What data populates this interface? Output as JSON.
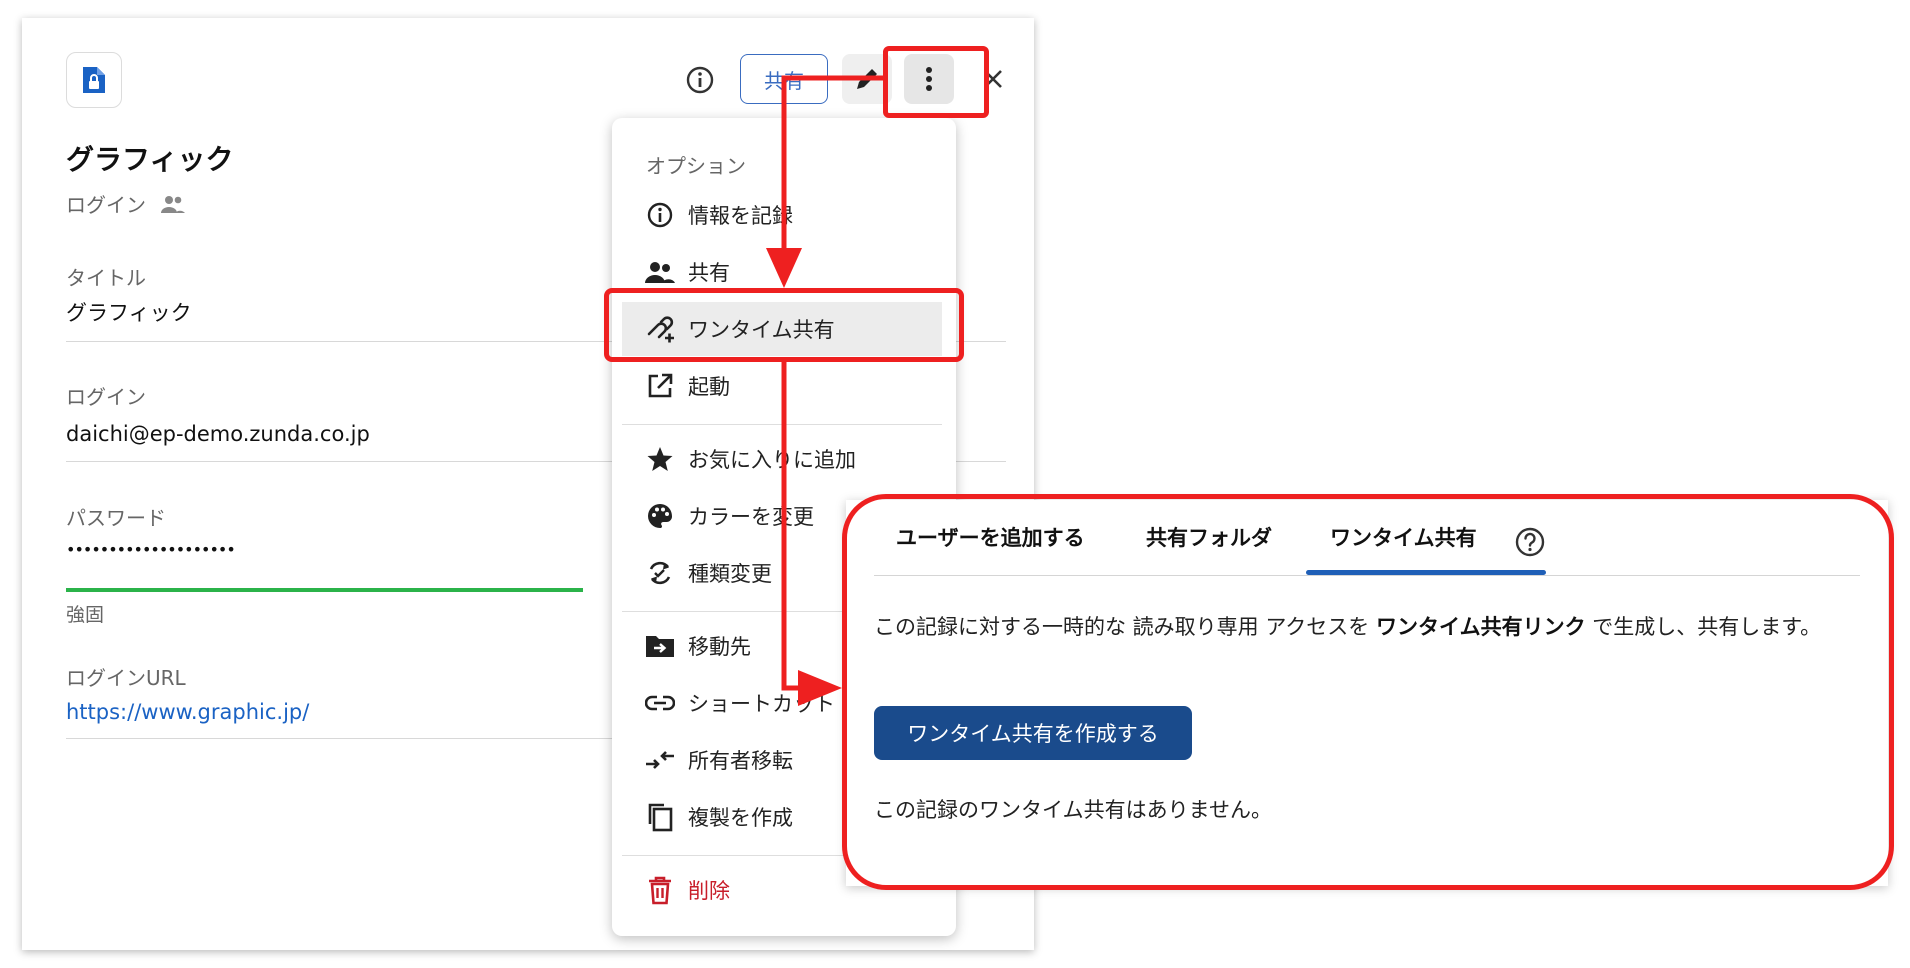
{
  "record": {
    "title": "グラフィック",
    "type_label": "ログイン",
    "fields": [
      {
        "label": "タイトル",
        "value": "グラフィック"
      },
      {
        "label": "ログイン",
        "value": "daichi@ep-demo.zunda.co.jp"
      },
      {
        "label": "パスワード",
        "value": "••••••••••••••••••••"
      },
      {
        "label": "ログインURL",
        "value": "https://www.graphic.jp/"
      }
    ],
    "password_strength": "強固",
    "password_strength_fraction": 0.55,
    "strength_color": "#2bb34a"
  },
  "header": {
    "share_label": "共有",
    "icons": [
      "file-lock-icon",
      "info-icon",
      "edit-icon",
      "more-vert-icon",
      "close-icon"
    ]
  },
  "options_menu": {
    "heading": "オプション",
    "items": [
      {
        "label": "情報を記録",
        "icon": "info-icon"
      },
      {
        "label": "共有",
        "icon": "people-icon"
      },
      {
        "label": "ワンタイム共有",
        "icon": "link-add-icon",
        "highlighted": true
      },
      {
        "label": "起動",
        "icon": "open-external-icon"
      },
      {
        "label": "お気に入りに追加",
        "icon": "star-icon"
      },
      {
        "label": "カラーを変更",
        "icon": "palette-icon"
      },
      {
        "label": "種類変更",
        "icon": "convert-icon"
      },
      {
        "label": "移動先",
        "icon": "move-folder-icon"
      },
      {
        "label": "ショートカット",
        "icon": "link-icon"
      },
      {
        "label": "所有者移転",
        "icon": "transfer-icon"
      },
      {
        "label": "複製を作成",
        "icon": "copy-icon"
      },
      {
        "label": "削除",
        "icon": "trash-icon",
        "danger": true
      }
    ]
  },
  "share_panel": {
    "tabs": [
      "ユーザーを追加する",
      "共有フォルダ",
      "ワンタイム共有"
    ],
    "active_tab": "ワンタイム共有",
    "desc_prefix": "この記録に対する一時的な 読み取り専用 アクセスを ",
    "desc_bold": "ワンタイム共有リンク",
    "desc_suffix": " で生成し、共有します。",
    "create_button": "ワンタイム共有を作成する",
    "empty_message": "この記録のワンタイム共有はありません。"
  },
  "colors": {
    "annotation_red": "#ee2020",
    "primary_blue": "#1a4b8c",
    "link_blue": "#1a62c4",
    "danger_red": "#c81e2a"
  }
}
